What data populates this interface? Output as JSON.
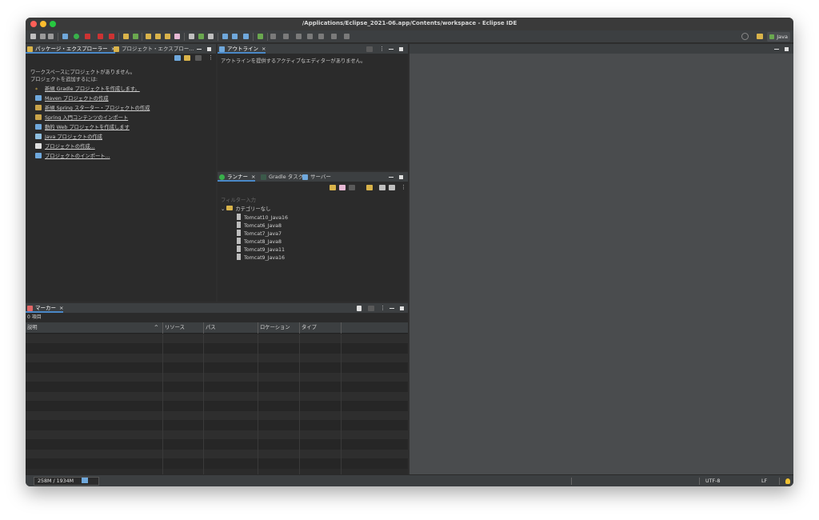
{
  "window": {
    "title": "/Applications/Eclipse_2021-06.app/Contents/workspace - Eclipse IDE"
  },
  "toolbar": {
    "perspective_label": "Java"
  },
  "package_explorer": {
    "tabs": [
      {
        "label": "パッケージ・エクスプローラー",
        "active": true
      },
      {
        "label": "プロジェクト・エクスプロー..."
      }
    ],
    "message_line1": "ワークスペースにプロジェクトがありません。",
    "message_line2": "プロジェクトを追加するには:",
    "links": [
      {
        "label": "新規 Gradle プロジェクトを作成します。",
        "icon": "gradle-icon"
      },
      {
        "label": "Maven プロジェクトの作成",
        "icon": "maven-icon"
      },
      {
        "label": "新規 Spring スターター・プロジェクトの作成",
        "icon": "spring-icon"
      },
      {
        "label": "Spring 入門コンテンツのインポート",
        "icon": "spring-import-icon"
      },
      {
        "label": "動的 Web プロジェクトを作成します",
        "icon": "web-project-icon"
      },
      {
        "label": "Java プロジェクトの作成",
        "icon": "java-project-icon"
      },
      {
        "label": "プロジェクトの作成...",
        "icon": "project-icon"
      },
      {
        "label": "プロジェクトのインポート...",
        "icon": "import-icon"
      }
    ]
  },
  "outline": {
    "tab_label": "アウトライン",
    "message": "アウトラインを提供するアクティブなエディターがありません。"
  },
  "servers": {
    "tabs": [
      {
        "label": "ランナー",
        "active": true
      },
      {
        "label": "Gradle タスク"
      },
      {
        "label": "サーバー"
      }
    ],
    "filter_placeholder": "フィルター入力",
    "category": "カテゴリーなし",
    "items": [
      "Tomcat10_Java16",
      "Tomcat6_Java8",
      "Tomcat7_Java7",
      "Tomcat8_Java8",
      "Tomcat9_Java11",
      "Tomcat9_Java16"
    ]
  },
  "markers": {
    "tab_label": "マーカー",
    "count_label": "0 項目",
    "columns": [
      "説明",
      "リソース",
      "パス",
      "ロケーション",
      "タイプ"
    ]
  },
  "status": {
    "heap": "258M / 1934M",
    "encoding": "UTF-8",
    "line_ending": "LF"
  }
}
